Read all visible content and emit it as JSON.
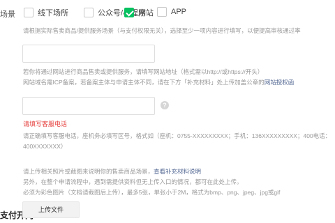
{
  "scene": {
    "label": "场景",
    "options": [
      {
        "label": "线下场所",
        "checked": false
      },
      {
        "label": "公众号/小程序",
        "checked": false
      },
      {
        "label": "网站",
        "checked": true
      },
      {
        "label": "APP",
        "checked": false
      }
    ],
    "hint": "请根据实际售卖商品/提供服务场景（与支付权限无关），选择至少一项内容进行填写，以便提高审核通过率"
  },
  "website": {
    "value": "",
    "hint_line1": "若你将通过网站进行商品售卖或提供服务，请填写网站地址（格式需以http://或https://开头）",
    "hint_line2_prefix": "网站域名需ICP备案，若备案主体与申请主体不同，请在下方「补充材料」处上传加盖公章的",
    "hint_line2_link": "网站授权函"
  },
  "phone": {
    "value": "",
    "help_icon": "question-circle-icon",
    "error": "请填写客服电话",
    "hint_line1": "请正确填写客服电话，座机务必填写区号，格式如（座机：0755-XXXXXXXXX；手机：136XXXXXXXXX；400电话：",
    "hint_line2": "400XXXXXXX）"
  },
  "supplement": {
    "hint_line1_prefix": "请上传相关照片或截图来说明你的售卖商品场景，",
    "hint_line1_link": "查看补充材料说明",
    "hint_line2": "另外，在整个申请流程中，遇到需提供资料但无上传入口的情况，都可在此处上传。",
    "hint_line3": "必须为彩色图片（文档请截图后上传），最多5张，单张小于2M，格式为bmp、png、jpeg、jpg或gif"
  },
  "payment": {
    "title": "支付开门",
    "upload_label": "上传文件"
  },
  "colors": {
    "accent_green": "#07c160",
    "error_red": "#e64340",
    "link_blue": "#576b95"
  }
}
